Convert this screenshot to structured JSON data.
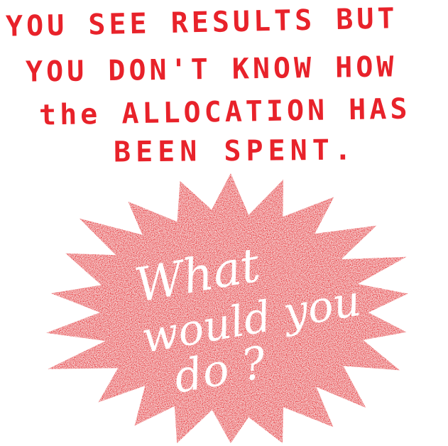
{
  "headline": {
    "line1": "YOU SEE RESULTS BUT",
    "line2": "YOU DON'T KNOW HOW",
    "line3": "the ALLOCATION HAS",
    "line4": "BEEN SPENT."
  },
  "burst": {
    "line1": "What",
    "line2": "would you",
    "line3": "do ?"
  },
  "colors": {
    "accent_red": "#e8222a",
    "background": "#ffffff",
    "burst_text": "#ffffff"
  }
}
